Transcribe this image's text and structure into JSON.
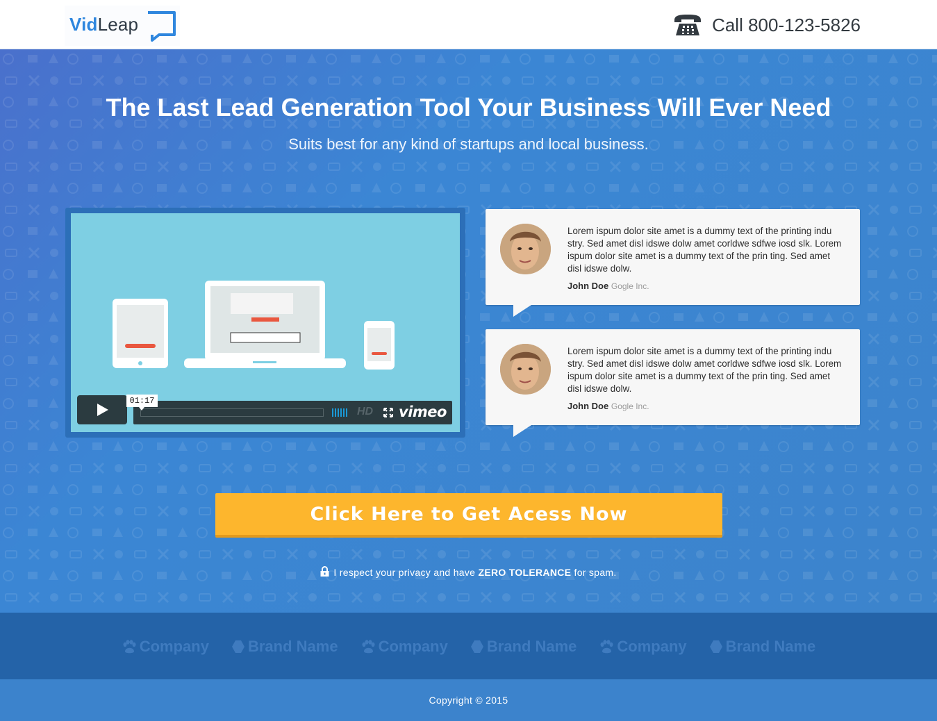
{
  "header": {
    "logo": {
      "part1": "Vid",
      "part2": "Leap"
    },
    "phone_label": "Call 800-123-5826"
  },
  "hero": {
    "headline": "The Last Lead Generation Tool Your Business Will Ever Need",
    "subhead": "Suits best for any kind of startups and local business."
  },
  "video": {
    "time": "01:17",
    "hd_label": "HD",
    "provider": "vimeo"
  },
  "testimonials": [
    {
      "quote": "Lorem ispum dolor site amet is a dummy text of the printing indu stry. Sed amet disl idswe dolw amet corldwe sdfwe iosd slk. Lorem ispum dolor site amet is a dummy text of the prin ting. Sed amet disl idswe dolw.",
      "name": "John Doe",
      "company": "Gogle Inc."
    },
    {
      "quote": "Lorem ispum dolor site amet is a dummy text of the printing indu stry. Sed amet disl idswe dolw amet corldwe sdfwe iosd slk. Lorem ispum dolor site amet is a dummy text of the prin ting. Sed amet disl idswe dolw.",
      "name": "John Doe",
      "company": "Gogle Inc."
    }
  ],
  "cta": {
    "label": "Click Here to Get Acess Now"
  },
  "privacy": {
    "before": "I respect your privacy and have ",
    "strong": "ZERO TOLERANCE",
    "after": " for spam."
  },
  "brands": [
    {
      "label": "Company",
      "icon": "paw-icon"
    },
    {
      "label": "Brand Name",
      "icon": "hexagon-icon"
    },
    {
      "label": "Company",
      "icon": "paw-icon"
    },
    {
      "label": "Brand Name",
      "icon": "hexagon-icon"
    },
    {
      "label": "Company",
      "icon": "paw-icon"
    },
    {
      "label": "Brand Name",
      "icon": "hexagon-icon"
    }
  ],
  "footer": {
    "copyright": "Copyright © 2015"
  },
  "colors": {
    "brand_blue": "#2e86de",
    "hero_blue": "#3c83cc",
    "cta_yellow": "#fdb62d",
    "brand_bar": "#2463a8"
  }
}
